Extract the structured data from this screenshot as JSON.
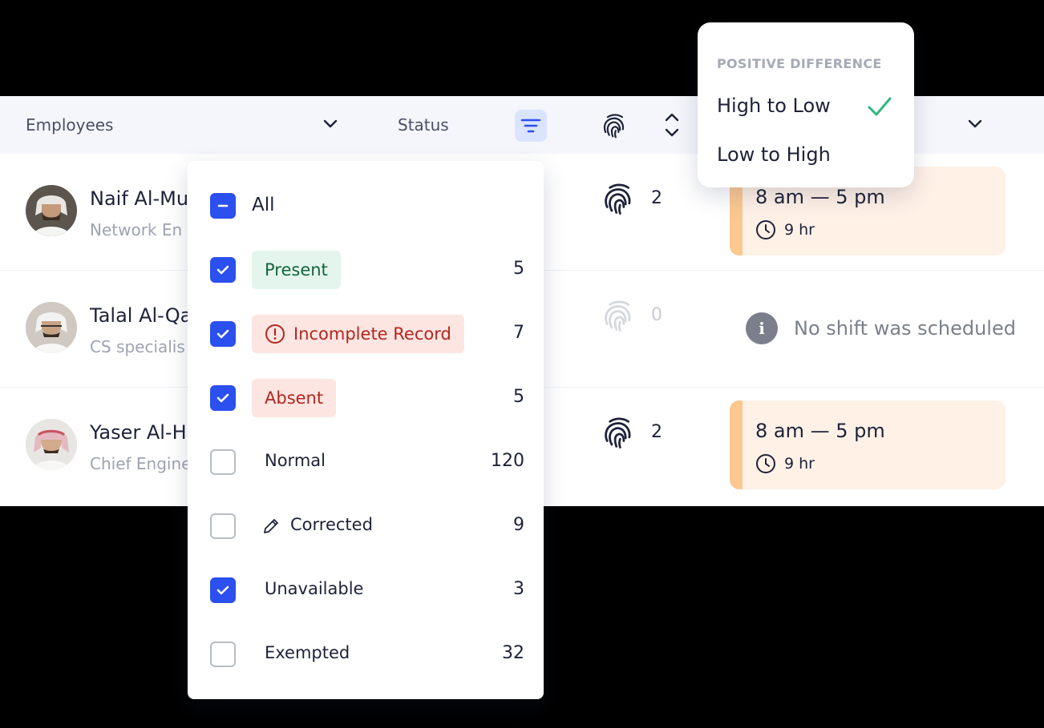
{
  "header": {
    "employees_label": "Employees",
    "status_label": "Status"
  },
  "employees": [
    {
      "name": "Naif Al-Mu",
      "role": "Network En",
      "punches": "2",
      "shift": {
        "time": "8 am — 5 pm",
        "duration": "9 hr"
      }
    },
    {
      "name": "Talal Al-Qa",
      "role": "CS specialis",
      "punches": "0",
      "no_shift": "No shift was scheduled"
    },
    {
      "name": "Yaser Al-H",
      "role": "Chief Engine",
      "punches": "2",
      "shift": {
        "time": "8 am — 5 pm",
        "duration": "9 hr"
      }
    }
  ],
  "status_filter": {
    "all_label": "All",
    "items": [
      {
        "label": "Present",
        "count": "5",
        "checked": true,
        "style": "present"
      },
      {
        "label": "Incomplete Record",
        "count": "7",
        "checked": true,
        "style": "incomplete"
      },
      {
        "label": "Absent",
        "count": "5",
        "checked": true,
        "style": "absent"
      },
      {
        "label": "Normal",
        "count": "120",
        "checked": false,
        "style": "plain"
      },
      {
        "label": "Corrected",
        "count": "9",
        "checked": false,
        "style": "corrected"
      },
      {
        "label": "Unavailable",
        "count": "3",
        "checked": true,
        "style": "plain"
      },
      {
        "label": "Exempted",
        "count": "32",
        "checked": false,
        "style": "plain"
      }
    ]
  },
  "sort_menu": {
    "heading": "POSITIVE DIFFERENCE",
    "options": [
      {
        "label": "High to Low",
        "selected": true
      },
      {
        "label": "Low to High",
        "selected": false
      }
    ]
  },
  "colors": {
    "accent": "#2b50ef",
    "check_green": "#2fb67c",
    "shift_bar": "#fcc890",
    "shift_bg": "#fff1e6"
  }
}
